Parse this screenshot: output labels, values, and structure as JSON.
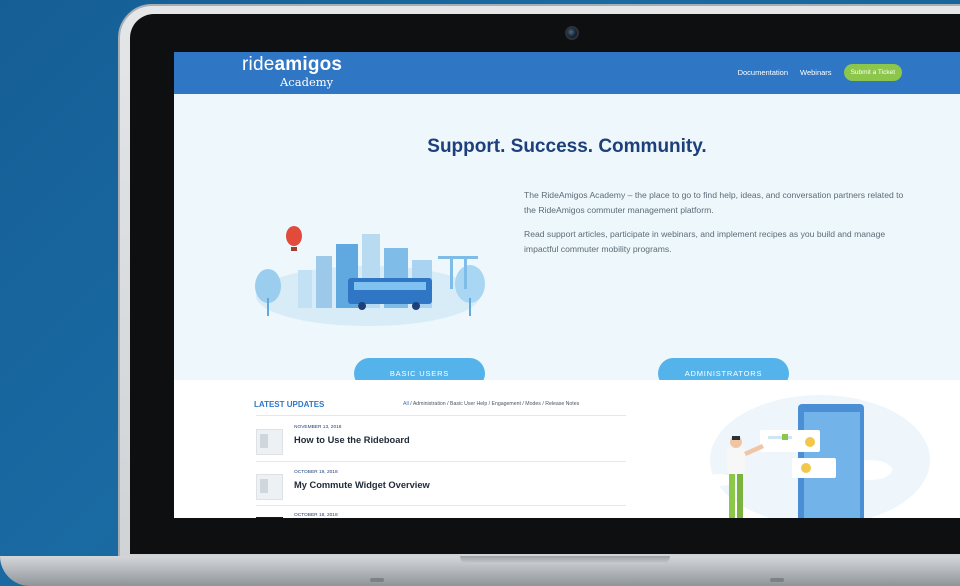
{
  "header": {
    "logo_prefix": "ride",
    "logo_bold": "amigos",
    "logo_sub": "Academy",
    "nav": [
      "Documentation",
      "Webinars"
    ],
    "ticket_label": "Submit a Ticket"
  },
  "hero": {
    "headline": "Support. Success. Community.",
    "paragraph1": "The RideAmigos Academy – the place to go to find help, ideas, and conversation partners related to the RideAmigos commuter management platform.",
    "paragraph2": "Read support articles, participate in webinars, and implement recipes as you build and manage impactful commuter mobility programs.",
    "basic_users_label": "BASIC USERS",
    "administrators_label": "ADMINISTRATORS"
  },
  "updates": {
    "heading": "LATEST UPDATES",
    "filters": [
      "All",
      "Administration",
      "Basic User Help",
      "Engagement",
      "Modes",
      "Release Notes"
    ],
    "items": [
      {
        "date": "NOVEMBER 13, 2018",
        "title": "How to Use the Rideboard"
      },
      {
        "date": "OCTOBER 19, 2018",
        "title": "My Commute Widget Overview"
      },
      {
        "date": "OCTOBER 18, 2018",
        "title": ""
      }
    ]
  },
  "colors": {
    "brand_blue": "#2f77c5",
    "ticket_green": "#8cc64a",
    "pill_blue": "#55b3ec",
    "headline_navy": "#1d3f7a",
    "background_blue": "#155e95"
  }
}
